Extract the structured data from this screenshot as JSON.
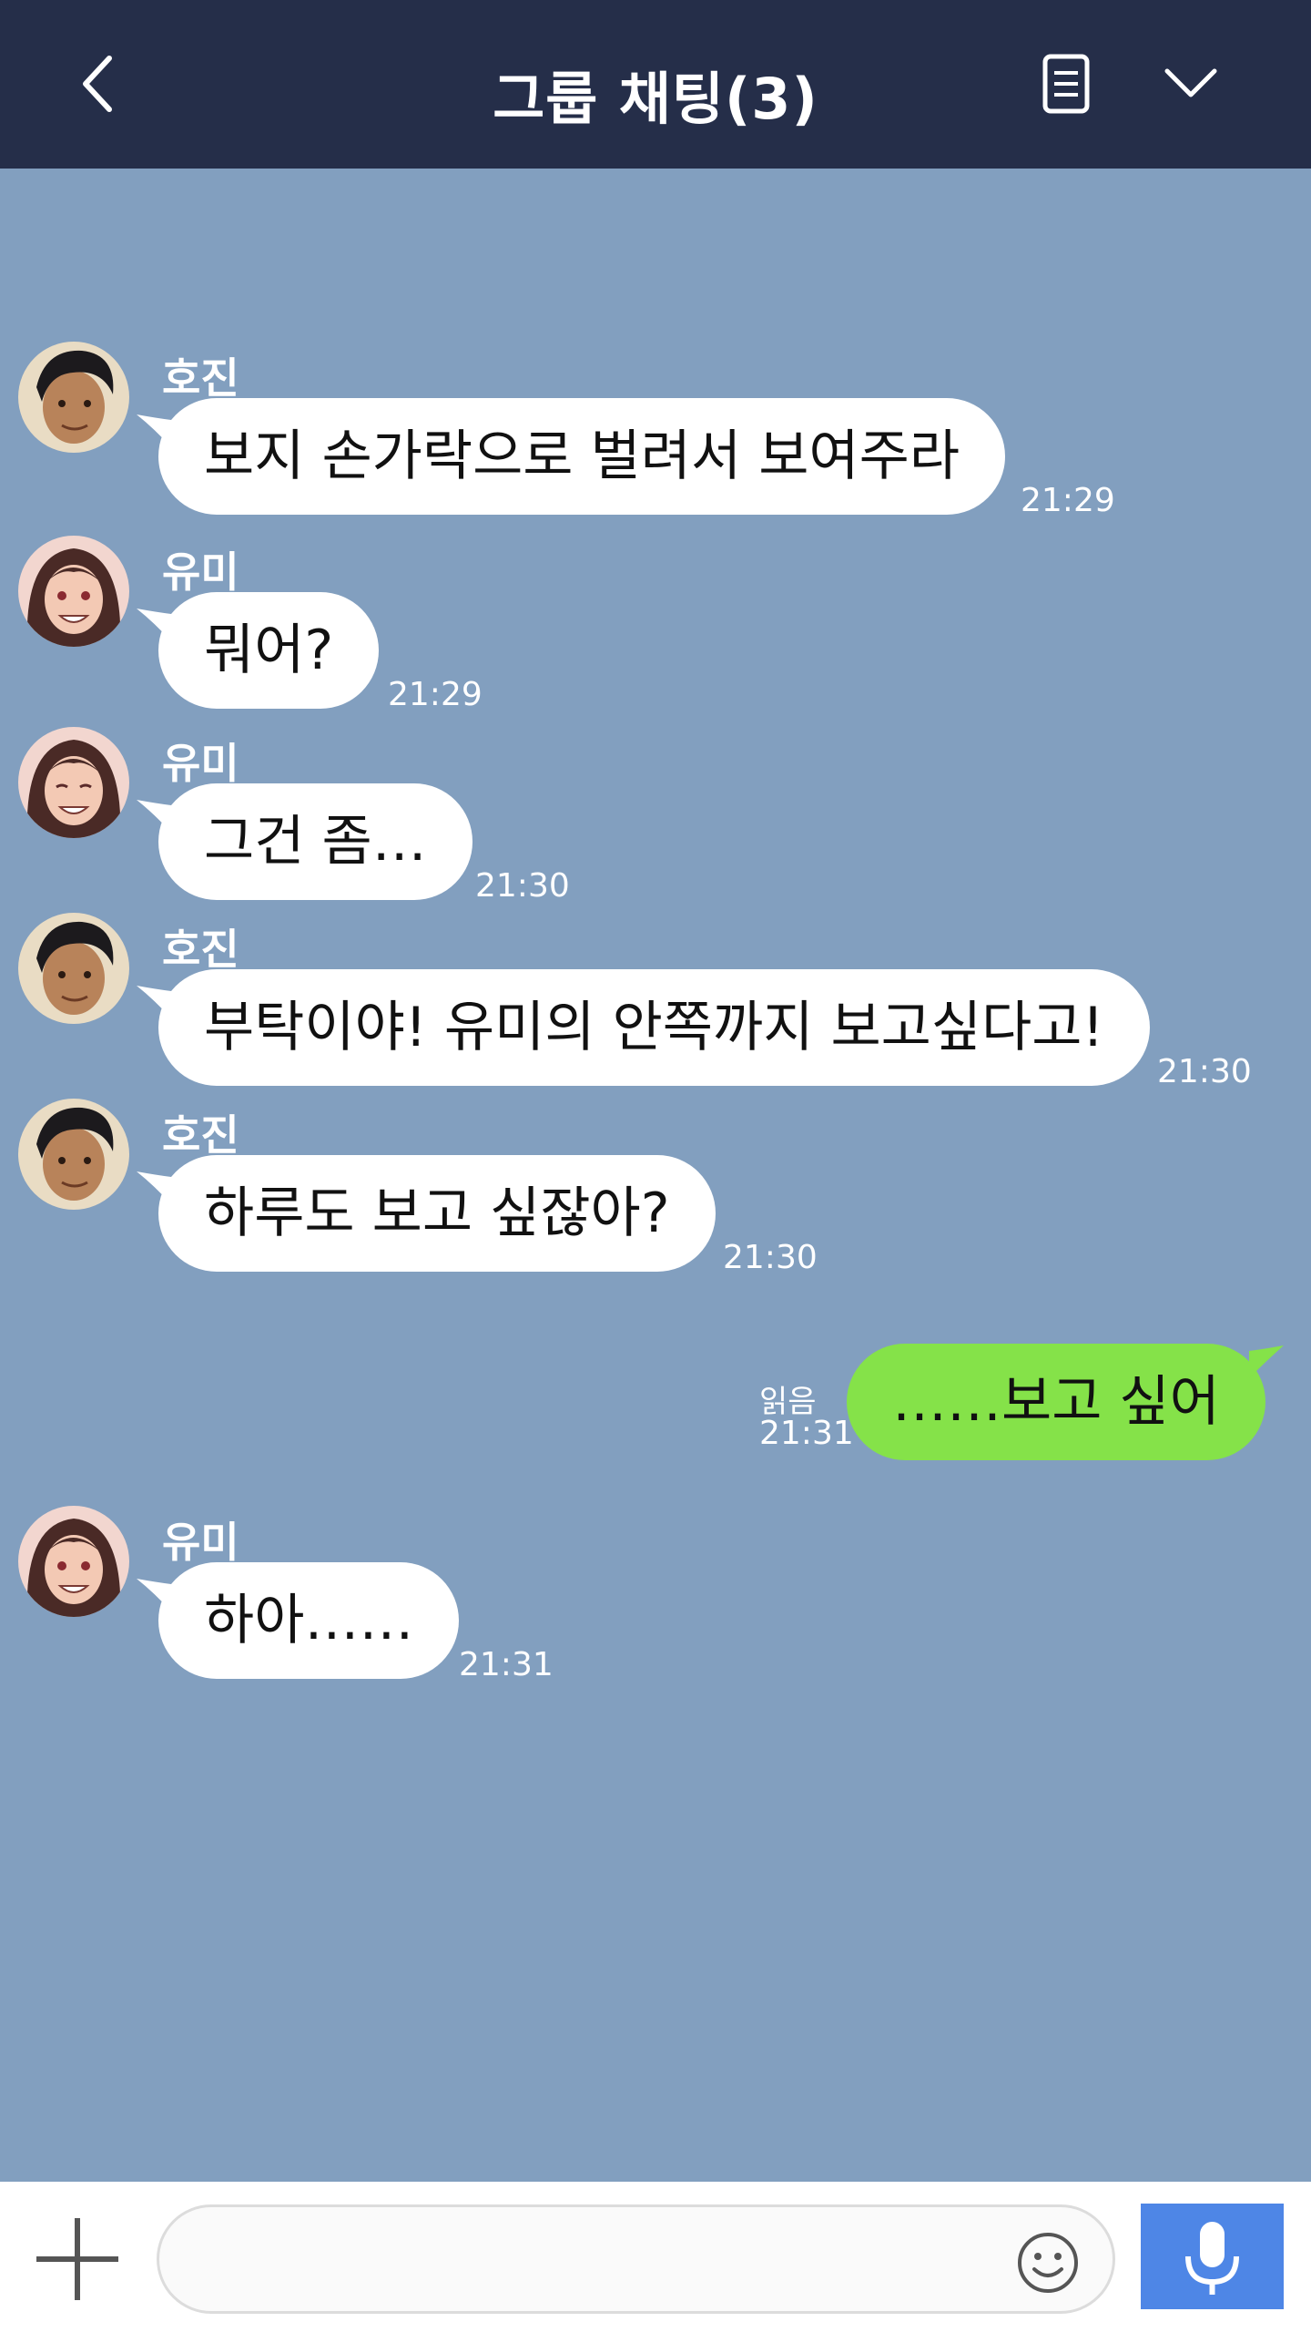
{
  "header": {
    "title": "그룹 채팅(3)",
    "back_icon": "chevron-left-icon",
    "menu_icon": "document-list-icon",
    "collapse_icon": "chevron-down-icon",
    "background_color": "#252e49"
  },
  "chat": {
    "background_color": "#829fbf",
    "messages": [
      {
        "sender": "호진",
        "text": "보지 손가락으로 벌려서 보여주라",
        "time": "21:29"
      },
      {
        "sender": "유미",
        "text": "뭐어?",
        "time": "21:29"
      },
      {
        "sender": "유미",
        "text": "그건 좀…",
        "time": "21:30"
      },
      {
        "sender": "호진",
        "text": "부탁이야! 유미의 안쪽까지 보고싶다고!",
        "time": "21:30"
      },
      {
        "sender": "호진",
        "text": "하루도 보고 싶잖아?",
        "time": "21:30"
      },
      {
        "text": "……보고 싶어",
        "read_status": "읽음",
        "time": "21:31"
      },
      {
        "sender": "유미",
        "text": "하아……",
        "time": "21:31"
      }
    ],
    "incoming_bubble_color": "#ffffff",
    "outgoing_bubble_color": "#85e249"
  },
  "footer": {
    "plus_icon": "plus-icon",
    "input_value": "",
    "emoji_icon": "smiley-icon",
    "mic_icon": "microphone-icon",
    "mic_button_color": "#4e86e6"
  }
}
